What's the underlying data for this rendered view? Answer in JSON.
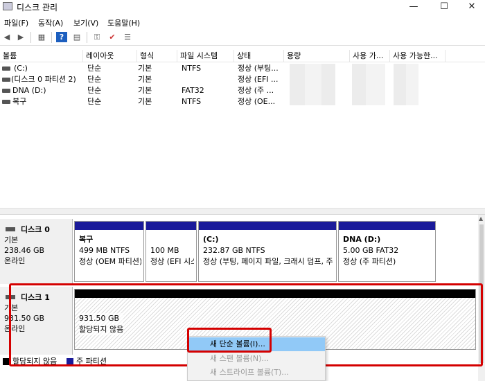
{
  "window": {
    "title": "디스크 관리",
    "minimize": "—",
    "maximize": "☐",
    "close": "✕"
  },
  "menu": [
    "파일(F)",
    "동작(A)",
    "보기(V)",
    "도움말(H)"
  ],
  "toolbar": {
    "back": "◀",
    "forward": "▶",
    "grid": "▦",
    "help": "?",
    "props": "▤",
    "key": "⚿",
    "check": "✔",
    "panel": "☰"
  },
  "columns": [
    "볼륨",
    "레이아웃",
    "형식",
    "파일 시스템",
    "상태",
    "용량",
    "사용 가...",
    "사용 가능한..."
  ],
  "volumes": [
    {
      "name": "(C:)",
      "layout": "단순",
      "type": "기본",
      "fs": "NTFS",
      "status": "정상 (부팅..."
    },
    {
      "name": "(디스크 0 파티션 2)",
      "layout": "단순",
      "type": "기본",
      "fs": "",
      "status": "정상 (EFI ..."
    },
    {
      "name": "DNA (D:)",
      "layout": "단순",
      "type": "기본",
      "fs": "FAT32",
      "status": "정상 (주 ..."
    },
    {
      "name": "복구",
      "layout": "단순",
      "type": "기본",
      "fs": "NTFS",
      "status": "정상 (OE..."
    }
  ],
  "disk0": {
    "name": "디스크 0",
    "kind": "기본",
    "size": "238.46 GB",
    "state": "온라인",
    "partitions": [
      {
        "title": "복구",
        "line1": "499 MB NTFS",
        "line2": "정상 (OEM 파티션)"
      },
      {
        "title": "",
        "line1": "100 MB",
        "line2": "정상 (EFI 시스템 파티션)"
      },
      {
        "title": "(C:)",
        "line1": "232.87 GB NTFS",
        "line2": "정상 (부팅, 페이지 파일, 크래시 덤프, 주 파티션)"
      },
      {
        "title": "DNA  (D:)",
        "line1": "5.00 GB FAT32",
        "line2": "정상 (주 파티션)"
      }
    ]
  },
  "disk1": {
    "name": "디스크 1",
    "kind": "기본",
    "size": "931.50 GB",
    "state": "온라인",
    "unallocated": {
      "size": "931.50 GB",
      "label": "할당되지 않음"
    }
  },
  "legend": {
    "unallocated": "할당되지 않음",
    "primary": "주 파티션"
  },
  "context_menu": [
    {
      "label": "새 단순 볼륨(I)...",
      "state": "highlighted"
    },
    {
      "label": "새 스팬 볼륨(N)...",
      "state": "disabled"
    },
    {
      "label": "새 스트라이프 볼륨(T)...",
      "state": "disabled"
    }
  ],
  "colors": {
    "primary_partition": "#1a1a9a",
    "unallocated": "#000000",
    "highlight_box": "#d40000",
    "menu_highlight": "#91c9f7"
  }
}
